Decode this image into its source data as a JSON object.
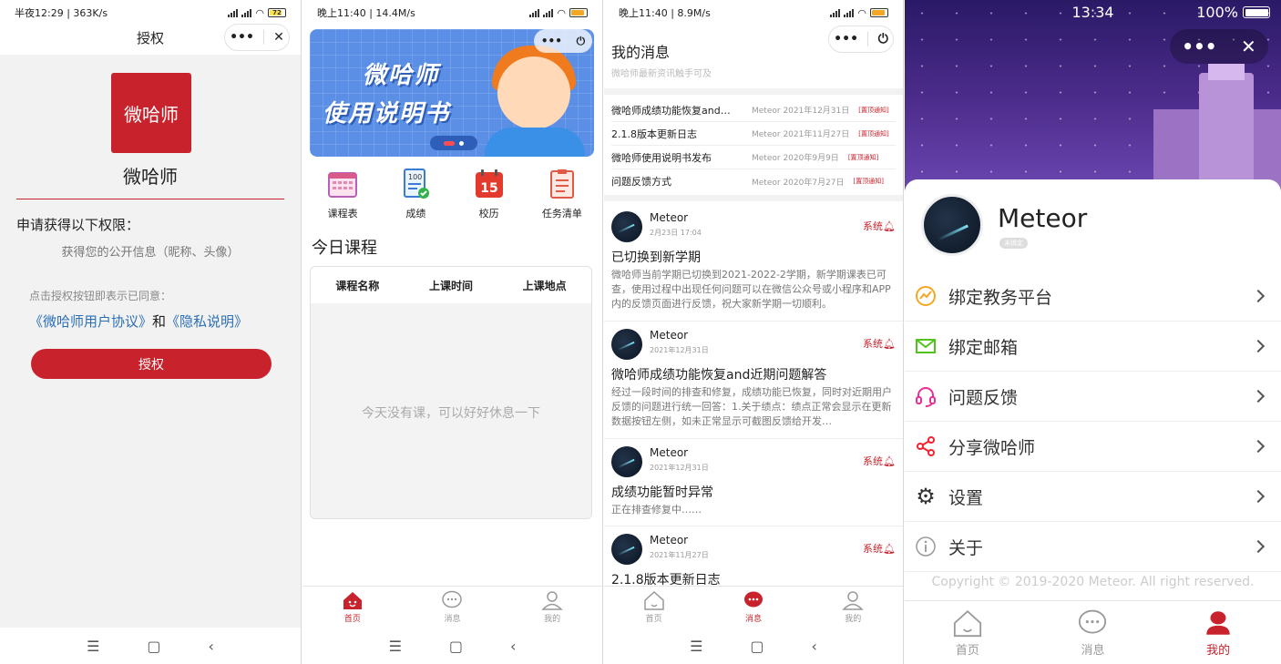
{
  "colors": {
    "brand_red": "#c8232c",
    "link_blue": "#2b6fb6"
  },
  "panel1": {
    "status": {
      "left": "半夜12:29 | 363K/s",
      "battery": "72"
    },
    "title": "授权",
    "logo_text": "微哈师",
    "app_name": "微哈师",
    "perm_title": "申请获得以下权限：",
    "perm_info": "获得您的公开信息（昵称、头像）",
    "agree_hint": "点击授权按钮即表示已同意：",
    "link_agreement": "《微哈师用户协议》",
    "and_text": "和",
    "link_privacy": "《隐私说明》",
    "auth_button": "授权"
  },
  "panel2": {
    "status": {
      "left": "晚上11:40 | 14.4M/s"
    },
    "banner": {
      "line1": "微哈师",
      "line2": "使用说明书"
    },
    "quick": [
      {
        "label": "课程表",
        "icon": "calendar-grid-icon"
      },
      {
        "label": "成绩",
        "icon": "score-report-icon"
      },
      {
        "label": "校历",
        "icon": "calendar-15-icon"
      },
      {
        "label": "任务清单",
        "icon": "checklist-icon"
      }
    ],
    "calendar_day": "15",
    "score_badge": "100",
    "today_title": "今日课程",
    "table_headers": [
      "课程名称",
      "上课时间",
      "上课地点"
    ],
    "empty_text": "今天没有课，可以好好休息一下",
    "tabs": [
      {
        "label": "首页",
        "icon": "home-icon",
        "active": true
      },
      {
        "label": "消息",
        "icon": "message-icon",
        "active": false
      },
      {
        "label": "我的",
        "icon": "user-icon",
        "active": false
      }
    ]
  },
  "panel3": {
    "status": {
      "left": "晚上11:40 | 8.9M/s"
    },
    "title": "我的消息",
    "subtitle": "微哈师最新资讯触手可及",
    "notices": [
      {
        "title": "微哈师成绩功能恢复and…",
        "author": "Meteor",
        "date": "2021年12月31日",
        "tag": "[置顶通知]"
      },
      {
        "title": "2.1.8版本更新日志",
        "author": "Meteor",
        "date": "2021年11月27日",
        "tag": "[置顶通知]"
      },
      {
        "title": "微哈师使用说明书发布",
        "author": "Meteor",
        "date": "2020年9月9日",
        "tag": "[置顶通知]"
      },
      {
        "title": "问题反馈方式",
        "author": "Meteor",
        "date": "2020年7月27日",
        "tag": "[置顶通知]"
      }
    ],
    "messages": [
      {
        "sender": "Meteor",
        "date": "2月23日 17:04",
        "badge": "系统",
        "title": "已切换到新学期",
        "body": "微哈师当前学期已切换到2021-2022-2学期，新学期课表已可查，使用过程中出现任何问题可以在微信公众号或小程序和APP内的反馈页面进行反馈，祝大家新学期一切顺利。"
      },
      {
        "sender": "Meteor",
        "date": "2021年12月31日",
        "badge": "系统",
        "title": "微哈师成绩功能恢复and近期问题解答",
        "body": "经过一段时间的排查和修复，成绩功能已恢复，同时对近期用户反馈的问题进行统一回答：1.关于绩点：绩点正常会显示在更新数据按钮左侧，如未正常显示可截图反馈给开发…"
      },
      {
        "sender": "Meteor",
        "date": "2021年12月31日",
        "badge": "系统",
        "title": "成绩功能暂时异常",
        "body": "正在排查修复中……"
      },
      {
        "sender": "Meteor",
        "date": "2021年11月27日",
        "badge": "系统",
        "title": "2.1.8版本更新日志",
        "body": ""
      }
    ],
    "tabs": [
      {
        "label": "首页",
        "icon": "home-icon",
        "active": false
      },
      {
        "label": "消息",
        "icon": "message-icon",
        "active": true
      },
      {
        "label": "我的",
        "icon": "user-icon",
        "active": false
      }
    ]
  },
  "panel4": {
    "status": {
      "time": "13:34",
      "battery": "100%"
    },
    "user_name": "Meteor",
    "user_badge": "未绑定",
    "menu": [
      {
        "label": "绑定教务平台",
        "icon": "edu-platform-icon",
        "color": "#f5a623"
      },
      {
        "label": "绑定邮箱",
        "icon": "mail-icon",
        "color": "#52c41a"
      },
      {
        "label": "问题反馈",
        "icon": "headset-icon",
        "color": "#eb2f96"
      },
      {
        "label": "分享微哈师",
        "icon": "share-icon",
        "color": "#f5222d"
      },
      {
        "label": "设置",
        "icon": "gear-icon",
        "color": "#333333"
      },
      {
        "label": "关于",
        "icon": "info-icon",
        "color": "#999999"
      }
    ],
    "copyright": "Copyright © 2019-2020 Meteor. All right reserved.",
    "tabs": [
      {
        "label": "首页",
        "icon": "home-icon",
        "active": false
      },
      {
        "label": "消息",
        "icon": "message-icon",
        "active": false
      },
      {
        "label": "我的",
        "icon": "user-icon",
        "active": true
      }
    ]
  }
}
